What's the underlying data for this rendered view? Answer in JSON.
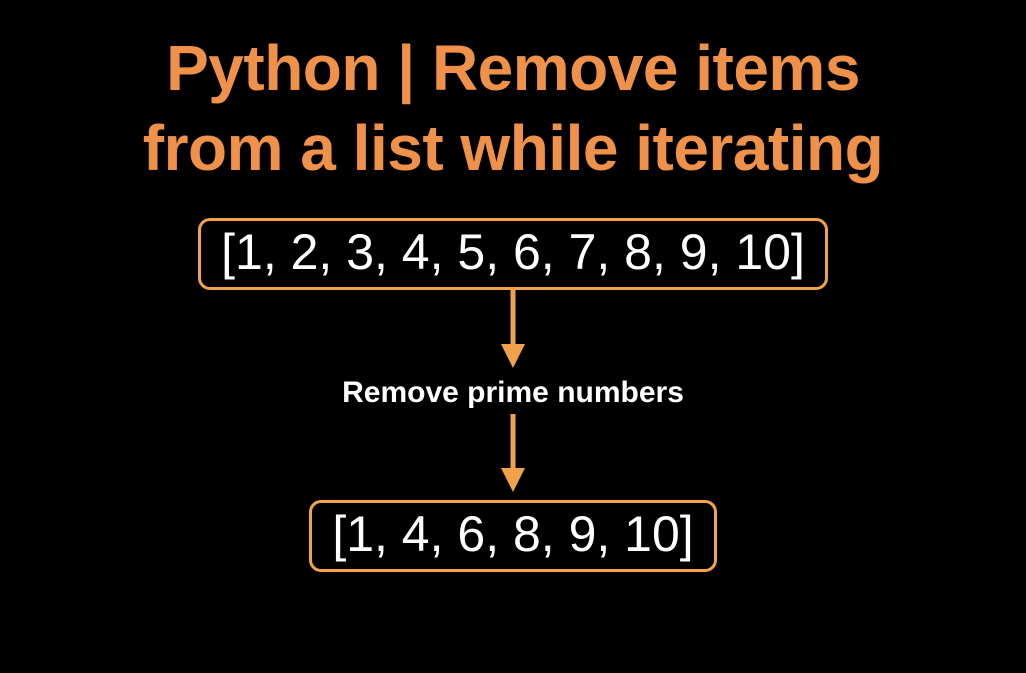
{
  "title_line1": "Python | Remove items",
  "title_line2": "from a list while iterating",
  "input_list": "[1, 2, 3, 4, 5, 6, 7, 8, 9, 10]",
  "arrow_label": "Remove prime numbers",
  "output_list": "[1, 4, 6, 8, 9, 10]",
  "colors": {
    "title": "#f0914a",
    "box_border": "#f0a34a",
    "arrow": "#f0a34a",
    "text": "#ffffff",
    "bg": "#000000"
  }
}
